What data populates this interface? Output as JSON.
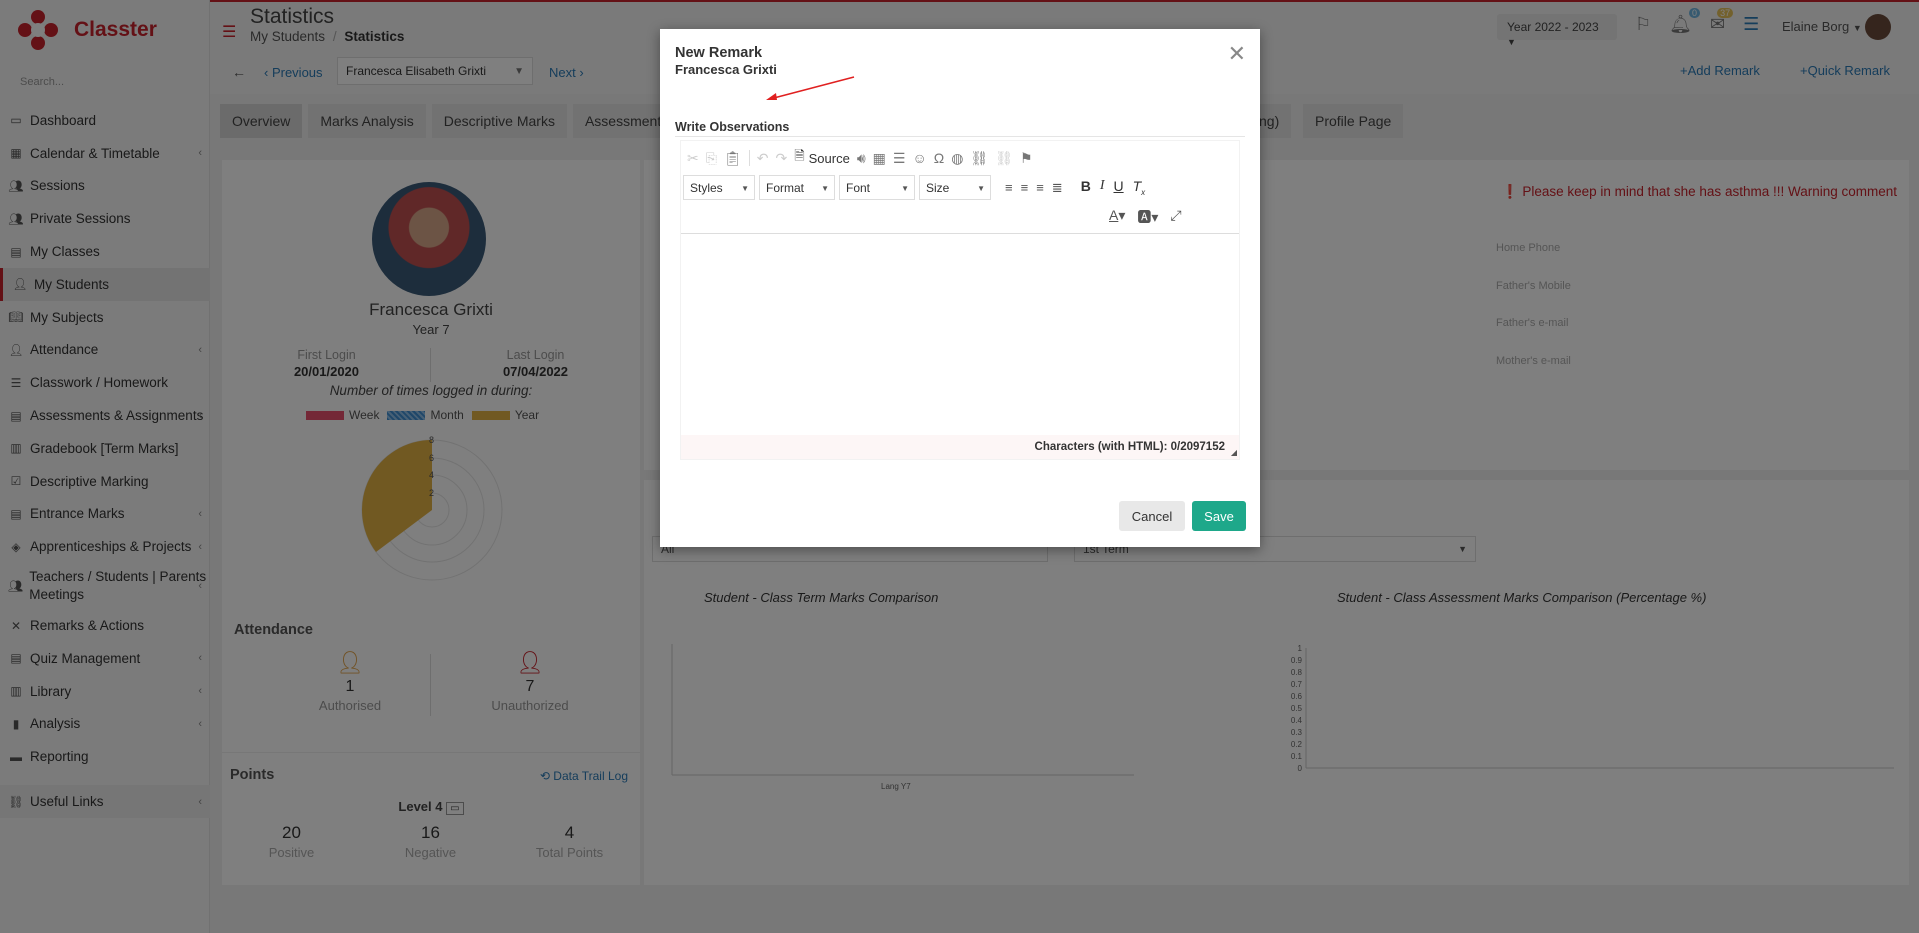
{
  "app": {
    "logo_text": "Classter",
    "search_placeholder": "Search..."
  },
  "sidebar": {
    "items": [
      {
        "label": "Dashboard",
        "icon": "monitor-icon",
        "chev": false
      },
      {
        "label": "Calendar & Timetable",
        "icon": "calendar-icon",
        "chev": true
      },
      {
        "label": "Sessions",
        "icon": "users-icon",
        "chev": false
      },
      {
        "label": "Private Sessions",
        "icon": "users-icon",
        "chev": false
      },
      {
        "label": "My Classes",
        "icon": "classes-icon",
        "chev": false
      },
      {
        "label": "My Students",
        "icon": "student-icon",
        "chev": false,
        "active": true
      },
      {
        "label": "My Subjects",
        "icon": "book-icon",
        "chev": false
      },
      {
        "label": "Attendance",
        "icon": "attendance-icon",
        "chev": true
      },
      {
        "label": "Classwork / Homework",
        "icon": "list-icon",
        "chev": false
      },
      {
        "label": "Assessments & Assignments",
        "icon": "assessment-icon",
        "chev": true
      },
      {
        "label": "Gradebook [Term Marks]",
        "icon": "gradebook-icon",
        "chev": false
      },
      {
        "label": "Descriptive Marking",
        "icon": "check-icon",
        "chev": false
      },
      {
        "label": "Entrance Marks",
        "icon": "doc-icon",
        "chev": true
      },
      {
        "label": "Apprenticeships & Projects",
        "icon": "layers-icon",
        "chev": true
      },
      {
        "label": "Teachers / Students | Parents Meetings",
        "icon": "meeting-icon",
        "chev": true
      },
      {
        "label": "Remarks & Actions",
        "icon": "remarks-icon",
        "chev": false
      },
      {
        "label": "Quiz Management",
        "icon": "quiz-icon",
        "chev": true
      },
      {
        "label": "Library",
        "icon": "library-icon",
        "chev": true
      },
      {
        "label": "Analysis",
        "icon": "chart-icon",
        "chev": true
      },
      {
        "label": "Reporting",
        "icon": "print-icon",
        "chev": false
      }
    ],
    "useful_links": "Useful Links"
  },
  "header": {
    "title": "Statistics",
    "breadcrumb_parent": "My Students",
    "breadcrumb_sep": "/",
    "breadcrumb_current": "Statistics",
    "year": "Year 2022 - 2023",
    "notif_badge": "0",
    "mail_badge": "37",
    "user_name": "Elaine Borg"
  },
  "student_bar": {
    "previous": "Previous",
    "selected_student": "Francesca Elisabeth Grixti",
    "next": "Next",
    "add_remark": "Add Remark",
    "quick_remark": "Quick Remark"
  },
  "tabs": [
    "Overview",
    "Marks Analysis",
    "Descriptive Marks",
    "Assessments"
  ],
  "tabs_right": [
    "ting)",
    "Profile Page"
  ],
  "profile": {
    "name": "Francesca Grixti",
    "year": "Year 7",
    "first_login_label": "First Login",
    "first_login": "20/01/2020",
    "last_login_label": "Last Login",
    "last_login": "07/04/2022",
    "logged_caption": "Number of times logged in during:",
    "legend": [
      {
        "name": "Week",
        "color": "#e8506f"
      },
      {
        "name": "Month",
        "color": "#3f8fd2"
      },
      {
        "name": "Year",
        "color": "#e3b244"
      }
    ],
    "polar_ticks": [
      "8",
      "6",
      "4",
      "2"
    ],
    "attendance_title": "Attendance",
    "authorised_count": "1",
    "authorised_label": "Authorised",
    "unauthorized_count": "7",
    "unauthorized_label": "Unauthorized",
    "points_title": "Points",
    "data_trail": "Data Trail Log",
    "level": "Level 4",
    "positive": "20",
    "positive_label": "Positive",
    "negative": "16",
    "negative_label": "Negative",
    "total": "4",
    "total_label": "Total Points"
  },
  "info": {
    "warning": "Please keep in mind that she has asthma !!! Warning comment",
    "labels": [
      "Home Phone",
      "Father's Mobile",
      "Father's e-mail",
      "Mother's e-mail"
    ]
  },
  "charts": {
    "dropdown1": "All",
    "dropdown2": "1st Term",
    "title_left": "Student - Class Term Marks Comparison",
    "title_right": "Student - Class Assessment Marks Comparison (Percentage %)",
    "x_label_left": "Lang Y7",
    "y_ticks_right": [
      "1",
      "0.9",
      "0.8",
      "0.7",
      "0.6",
      "0.5",
      "0.4",
      "0.3",
      "0.2",
      "0.1",
      "0"
    ]
  },
  "modal": {
    "title": "New Remark",
    "subtitle": "Francesca Grixti",
    "label": "Write Observations",
    "source": "Source",
    "styles": "Styles",
    "format": "Format",
    "font": "Font",
    "size": "Size",
    "status": "Characters (with HTML): 0/2097152",
    "cancel": "Cancel",
    "save": "Save"
  }
}
